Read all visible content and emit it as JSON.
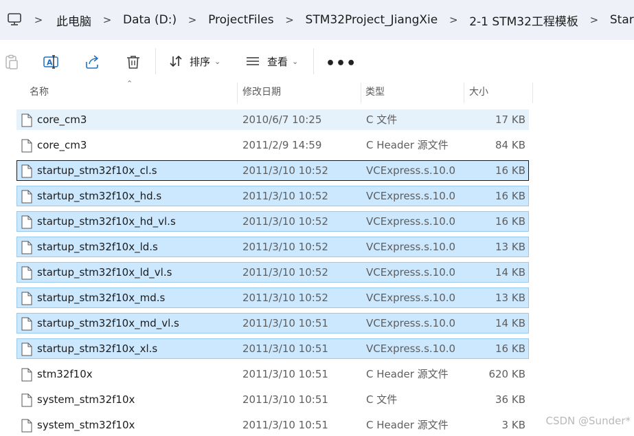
{
  "breadcrumb": [
    "此电脑",
    "Data (D:)",
    "ProjectFiles",
    "STM32Project_JiangXie",
    "2-1 STM32工程模板",
    "Start"
  ],
  "toolbar": {
    "sort_label": "排序",
    "view_label": "查看",
    "more_label": "•••"
  },
  "columns": {
    "name": "名称",
    "date": "修改日期",
    "type": "类型",
    "size": "大小"
  },
  "files": [
    {
      "name": "core_cm3",
      "date": "2010/6/7 10:25",
      "type": "C 文件",
      "size": "17 KB",
      "state": "hover"
    },
    {
      "name": "core_cm3",
      "date": "2011/2/9 14:59",
      "type": "C Header 源文件",
      "size": "84 KB",
      "state": "normal"
    },
    {
      "name": "startup_stm32f10x_cl.s",
      "date": "2011/3/10 10:52",
      "type": "VCExpress.s.10.0",
      "size": "16 KB",
      "state": "focused"
    },
    {
      "name": "startup_stm32f10x_hd.s",
      "date": "2011/3/10 10:52",
      "type": "VCExpress.s.10.0",
      "size": "16 KB",
      "state": "selected"
    },
    {
      "name": "startup_stm32f10x_hd_vl.s",
      "date": "2011/3/10 10:52",
      "type": "VCExpress.s.10.0",
      "size": "16 KB",
      "state": "selected"
    },
    {
      "name": "startup_stm32f10x_ld.s",
      "date": "2011/3/10 10:52",
      "type": "VCExpress.s.10.0",
      "size": "13 KB",
      "state": "selected"
    },
    {
      "name": "startup_stm32f10x_ld_vl.s",
      "date": "2011/3/10 10:52",
      "type": "VCExpress.s.10.0",
      "size": "14 KB",
      "state": "selected"
    },
    {
      "name": "startup_stm32f10x_md.s",
      "date": "2011/3/10 10:52",
      "type": "VCExpress.s.10.0",
      "size": "13 KB",
      "state": "selected"
    },
    {
      "name": "startup_stm32f10x_md_vl.s",
      "date": "2011/3/10 10:51",
      "type": "VCExpress.s.10.0",
      "size": "14 KB",
      "state": "selected"
    },
    {
      "name": "startup_stm32f10x_xl.s",
      "date": "2011/3/10 10:51",
      "type": "VCExpress.s.10.0",
      "size": "16 KB",
      "state": "selected"
    },
    {
      "name": "stm32f10x",
      "date": "2011/3/10 10:51",
      "type": "C Header 源文件",
      "size": "620 KB",
      "state": "normal"
    },
    {
      "name": "system_stm32f10x",
      "date": "2011/3/10 10:51",
      "type": "C 文件",
      "size": "36 KB",
      "state": "normal"
    },
    {
      "name": "system_stm32f10x",
      "date": "2011/3/10 10:51",
      "type": "C Header 源文件",
      "size": "3 KB",
      "state": "normal"
    }
  ],
  "watermark": "CSDN @Sunder*",
  "colors": {
    "address_bg": "#eef2f8",
    "selected_bg": "#cce8ff",
    "selected_border": "#99c9ef",
    "hover_bg": "#e5f1fb"
  }
}
